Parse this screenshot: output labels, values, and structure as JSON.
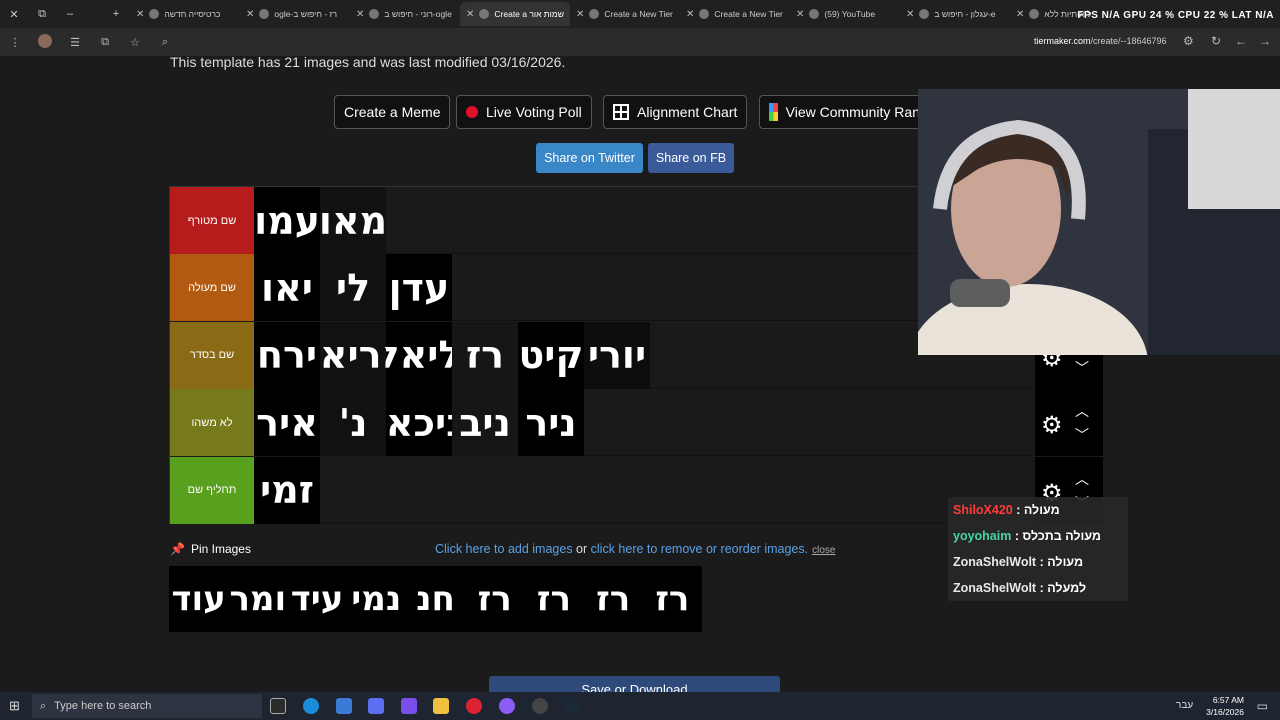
{
  "browser": {
    "tabs": [
      {
        "label": "כרטיסייה חדשה",
        "active": false
      },
      {
        "label": "ogle-רז - חיפוש ב",
        "active": false
      },
      {
        "label": "רוני - חיפוש ב-ogle",
        "active": false
      },
      {
        "label": "Create a שמות אור",
        "active": true
      },
      {
        "label": "Create a New Tier",
        "active": false
      },
      {
        "label": "Create a New Tier",
        "active": false
      },
      {
        "label": "(59) YouTube",
        "active": false
      },
      {
        "label": "עגלון - חיפוש ב-e",
        "active": false
      },
      {
        "label": "ל אותיות ללא",
        "active": false
      }
    ],
    "url_domain": "tiermaker.com",
    "url_path": "/create/--18646796",
    "stats": "FPS N/A  GPU 24 %  CPU 22 %  LAT N/A"
  },
  "page": {
    "template_note": "This template has 21 images and was last modified 03/16/2026.",
    "buttons": {
      "meme": "Create a Meme",
      "voting": "Live Voting Poll",
      "alignment": "Alignment Chart",
      "community": "View Community Ran"
    },
    "share_twitter": "Share on Twitter",
    "share_fb": "Share on FB",
    "tiers": [
      {
        "label": "שם מטורף",
        "color": "#b71c1c",
        "items": [
          "עמו",
          "מאו"
        ]
      },
      {
        "label": "שם מעולה",
        "color": "#b35a12",
        "items": [
          "יאו",
          "לי",
          "עדן"
        ]
      },
      {
        "label": "שם בסדר",
        "color": "#8a6a14",
        "items": [
          "ירח",
          "אריאל",
          "ליאל",
          "רז",
          "קיט",
          "יורי"
        ]
      },
      {
        "label": "לא משהו",
        "color": "#777a1a",
        "items": [
          "איר",
          "'נ",
          "ניכאי",
          "ניב",
          "ניר"
        ]
      },
      {
        "label": "תחליף שם",
        "color": "#59a01e",
        "items": [
          "זמי"
        ]
      }
    ],
    "pin_images": "Pin Images",
    "add_images_link": "Click here to add images",
    "or_text": " or ",
    "remove_images_link": "click here to remove or reorder images.",
    "close_link": "close",
    "pool_items": [
      "עוד",
      "ומר",
      "עיד",
      "נמי",
      "חנ",
      "רז",
      "רז",
      "רז",
      "רז"
    ],
    "save_button": "Save or Download"
  },
  "chat": [
    {
      "user": "ShiloX420",
      "color": "#ff3b3b",
      "message": "מעולה"
    },
    {
      "user": "yoyohaim",
      "color": "#48d6a0",
      "message": "מעולה בתכלס"
    },
    {
      "user": "ZonaShelWolt",
      "color": "#e8e8e8",
      "message": "מעולה"
    },
    {
      "user": "ZonaShelWolt",
      "color": "#e8e8e8",
      "message": "למעלה"
    }
  ],
  "taskbar": {
    "search_placeholder": "Type here to search",
    "time": "6:57 AM",
    "date": "3/16/2026",
    "lang": "עבר"
  }
}
